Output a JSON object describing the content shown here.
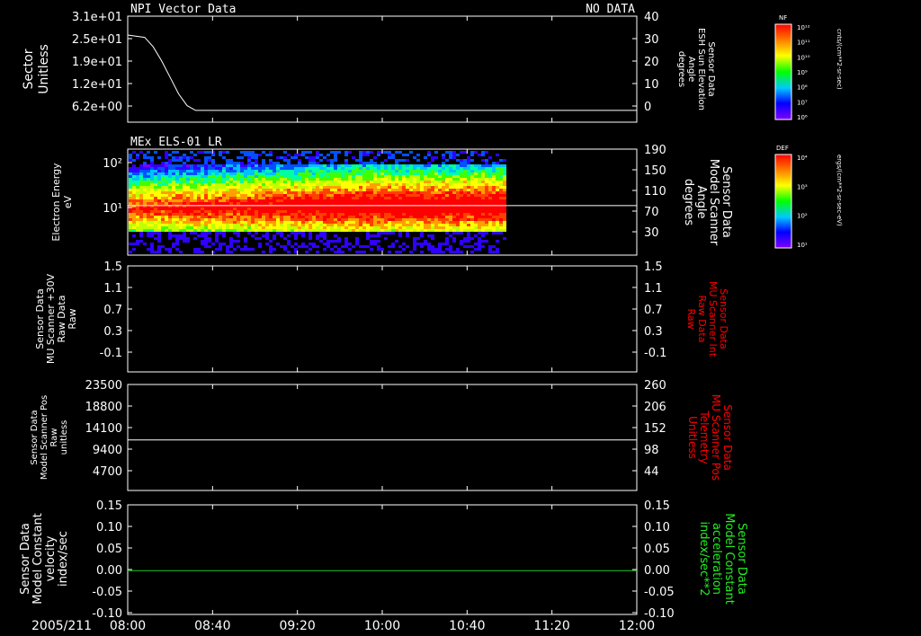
{
  "chart_data": [
    {
      "id": "p1",
      "type": "line",
      "title": "NPI Vector Data",
      "status": "NO DATA",
      "ylabel": [
        "Sector",
        "Unitless"
      ],
      "yticks": [
        "3.1e+01",
        "2.5e+01",
        "1.9e+01",
        "1.2e+01",
        "6.2e+00"
      ],
      "y2label": [
        "Sensor Data",
        "ESH Sun Elevation",
        "Angle",
        "degrees"
      ],
      "y2ticks": [
        "40",
        "30",
        "20",
        "10",
        "0"
      ],
      "ylim": [
        -5,
        40
      ],
      "series": [
        {
          "color": "#ffffff",
          "x": [
            "08:00",
            "08:08",
            "08:12",
            "08:16",
            "08:20",
            "08:24",
            "08:28",
            "08:32",
            "08:36",
            "12:00"
          ],
          "y": [
            32,
            31,
            27,
            21,
            14,
            7,
            2,
            0,
            0,
            0
          ]
        }
      ]
    },
    {
      "id": "p2",
      "type": "heatmap",
      "title": "MEx ELS-01 LR",
      "ylabel": [
        "Electron Energy",
        "eV"
      ],
      "yticks": [
        "10²",
        "10¹"
      ],
      "ylog": true,
      "ylim": [
        1,
        200
      ],
      "y2label": [
        "Sensor Data",
        "Model Scanner",
        "Angle",
        "degrees"
      ],
      "y2ticks": [
        "190",
        "150",
        "110",
        "70",
        "30"
      ],
      "data_until": "10:58",
      "overlay_line": {
        "y2": 94,
        "color": "#ffffff"
      }
    },
    {
      "id": "p3",
      "type": "line",
      "ylabel": [
        "Sensor Data",
        "MU Scanner +30V",
        "Raw Data",
        "Raw"
      ],
      "yticks": [
        "1.5",
        "1.1",
        "0.7",
        "0.3",
        "-0.1"
      ],
      "y2label": [
        "Sensor Data",
        "MU Scanner Int",
        "Raw Data",
        "Raw"
      ],
      "y2ticks": [
        "1.5",
        "1.1",
        "0.7",
        "0.3",
        "-0.1"
      ],
      "series": []
    },
    {
      "id": "p4",
      "type": "line",
      "ylabel": [
        "Sensor Data",
        "Model Scanner Pos",
        "Raw",
        "unitless"
      ],
      "yticks": [
        "23500",
        "18800",
        "14100",
        "9400",
        "4700"
      ],
      "y2label": [
        "Sensor Data",
        "MU Scanner Pos",
        "Telemetry",
        "Unitless"
      ],
      "y2ticks": [
        "260",
        "206",
        "152",
        "98",
        "44"
      ],
      "ylim": [
        0,
        23500
      ],
      "series": [
        {
          "color": "#ffffff",
          "x": [
            "08:00",
            "12:00"
          ],
          "y": [
            11200,
            11200
          ]
        }
      ]
    },
    {
      "id": "p5",
      "type": "line",
      "ylabel": [
        "Sensor Data",
        "Model Constant",
        "velocity",
        "index/sec"
      ],
      "yticks": [
        "0.15",
        "0.10",
        "0.05",
        "0.00",
        "-0.05",
        "-0.10"
      ],
      "y2label": [
        "Sensor Data",
        "Model Constant",
        "acceleration",
        "index/sec**2"
      ],
      "y2ticks": [
        "0.15",
        "0.10",
        "0.05",
        "0.00",
        "-0.05",
        "-0.10"
      ],
      "ylim": [
        -0.1,
        0.15
      ],
      "series": [
        {
          "color": "#22cc22",
          "x": [
            "08:00",
            "12:00"
          ],
          "y": [
            0,
            0
          ]
        }
      ]
    }
  ],
  "xaxis": {
    "date": "2005/211",
    "ticks": [
      "08:00",
      "08:40",
      "09:20",
      "10:00",
      "10:40",
      "11:20",
      "12:00"
    ]
  },
  "colorbars": [
    {
      "title": "NF",
      "label": "cnts/(cm**2-sr-sec)",
      "ticks": [
        "10¹²",
        "10¹¹",
        "10¹⁰",
        "10⁹",
        "10⁸",
        "10⁷",
        "10⁶"
      ]
    },
    {
      "title": "DEF",
      "label": "ergs/(cm**2-sr-sec-eV)",
      "ticks": [
        "10⁴",
        "10³",
        "10²",
        "10¹"
      ]
    }
  ],
  "colors": {
    "axis": "#ffffff",
    "right_label_p3": "#ff0000",
    "right_label_p4": "#ff0000",
    "right_label_p5": "#22ee22"
  }
}
